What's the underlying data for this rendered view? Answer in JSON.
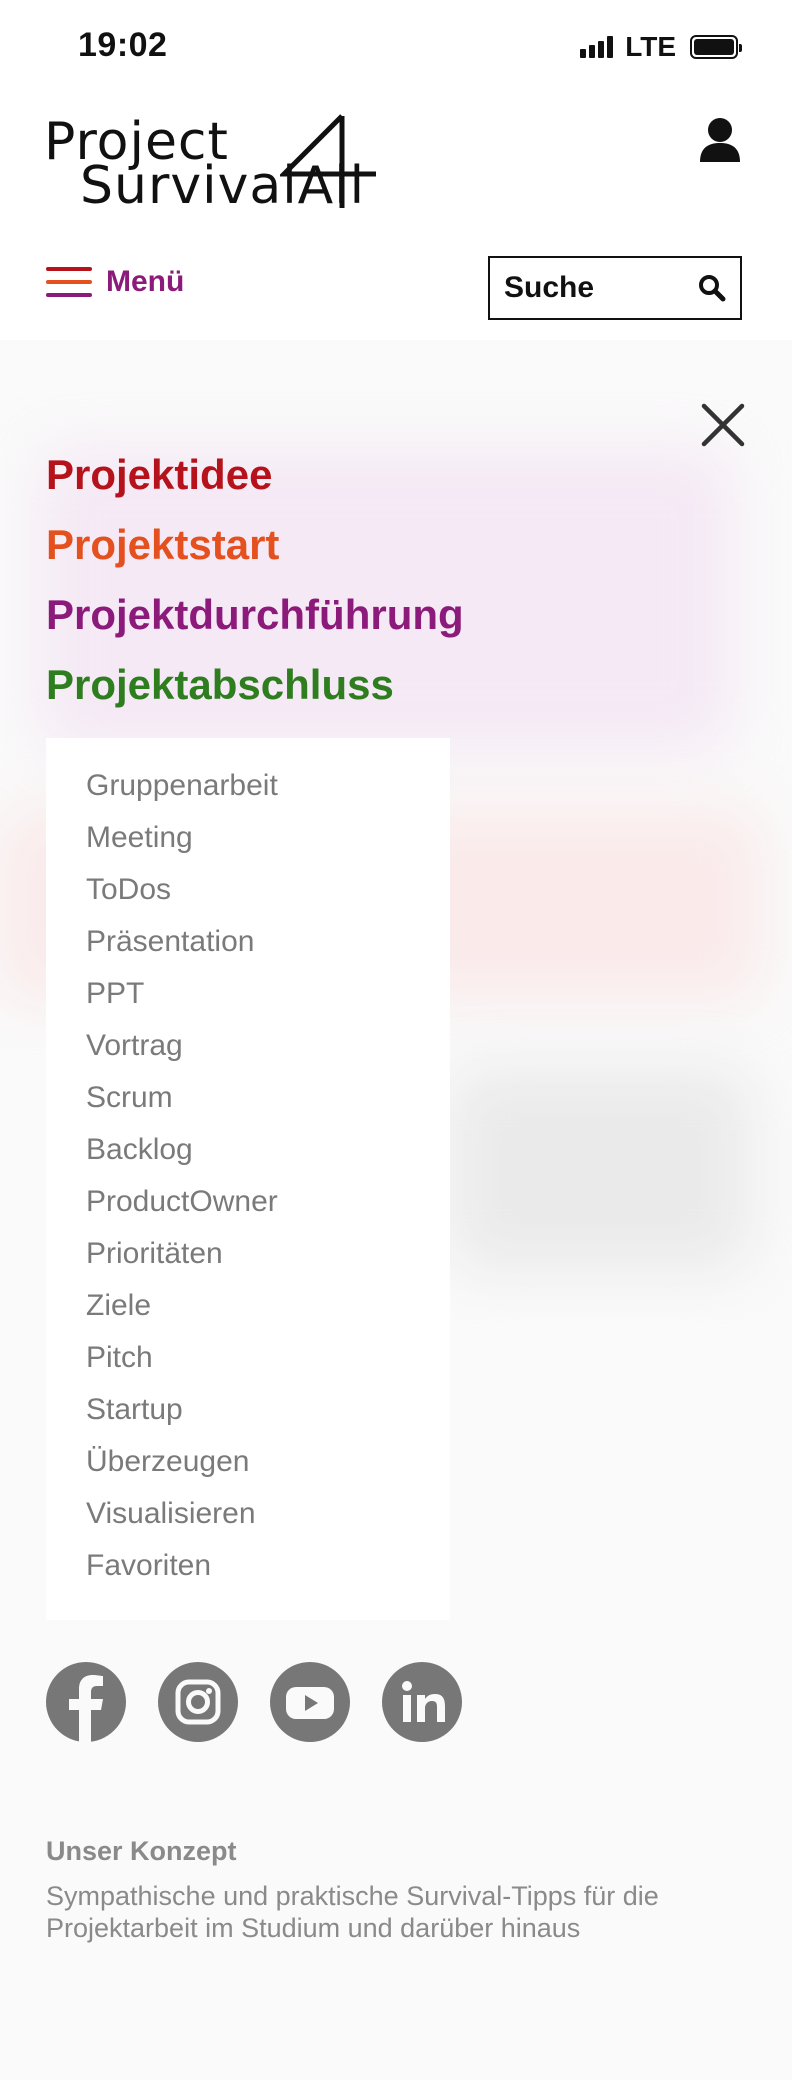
{
  "status_bar": {
    "time": "19:02",
    "network": "LTE"
  },
  "logo": {
    "line1": "Project",
    "line2": "SurvivalAll",
    "digit": "4"
  },
  "header": {
    "menu_label": "Menü",
    "search_label": "Suche",
    "icons": {
      "user": "user-icon",
      "hamburger": "hamburger-icon",
      "search": "search-icon"
    }
  },
  "phases": [
    {
      "label": "Projektidee",
      "color": "#b5121b"
    },
    {
      "label": "Projektstart",
      "color": "#e4501e"
    },
    {
      "label": "Projektdurchführung",
      "color": "#8b1a7a"
    },
    {
      "label": "Projektabschluss",
      "color": "#2e7d1f"
    }
  ],
  "submenu": [
    "Gruppenarbeit",
    "Meeting",
    "ToDos",
    "Präsentation",
    "PPT",
    "Vortrag",
    "Scrum",
    "Backlog",
    "ProductOwner",
    "Prioritäten",
    "Ziele",
    "Pitch",
    "Startup",
    "Überzeugen",
    "Visualisieren",
    "Favoriten"
  ],
  "social": [
    "facebook-icon",
    "instagram-icon",
    "youtube-icon",
    "linkedin-icon"
  ],
  "footer": {
    "concept_title": "Unser Konzept",
    "concept_text": "Sympathische und praktische Survival-Tipps für die Projektarbeit im Studium und darüber hinaus"
  },
  "colors": {
    "menu_accent": "#8b1a7a",
    "hamburger_top": "#b5121b",
    "hamburger_mid": "#e4501e",
    "hamburger_bottom": "#8b1a7a",
    "social_bg": "#777777"
  }
}
